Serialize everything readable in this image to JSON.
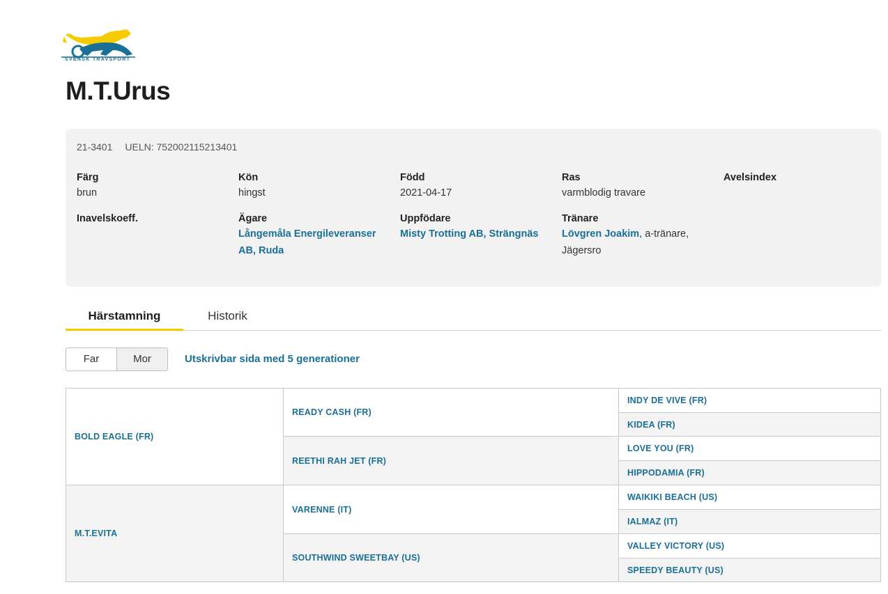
{
  "brand": {
    "logo_text": "SVENSK TRAVSPORT",
    "yellow": "#f4cc00",
    "blue": "#1a6f96"
  },
  "horse": {
    "name": "M.T.Urus",
    "reg_no": "21-3401",
    "ueln": "UELN: 752002115213401"
  },
  "info": {
    "farg": {
      "label": "Färg",
      "value": "brun"
    },
    "kon": {
      "label": "Kön",
      "value": "hingst"
    },
    "fodd": {
      "label": "Född",
      "value": "2021-04-17"
    },
    "ras": {
      "label": "Ras",
      "value": "varmblodig travare"
    },
    "avelsindex": {
      "label": "Avelsindex"
    },
    "inavel": {
      "label": "Inavelskoeff."
    },
    "agare": {
      "label": "Ägare",
      "line1": "Långemåla Energileveranser",
      "line2": "AB, Ruda"
    },
    "uppfodare": {
      "label": "Uppfödare",
      "value": "Misty Trotting AB, Strängnäs"
    },
    "tranare": {
      "label": "Tränare",
      "name": "Lövgren Joakim",
      "suffix": ", a-tränare,",
      "line2": "Jägersro"
    }
  },
  "tabs": {
    "pedigree": "Härstamning",
    "history": "Historik"
  },
  "toggle": {
    "father": "Far",
    "mother": "Mor"
  },
  "print_link": "Utskrivbar sida med 5 generationer",
  "pedigree": {
    "gen1": [
      "BOLD EAGLE (FR)",
      "M.T.EVITA"
    ],
    "gen2": [
      "READY CASH (FR)",
      "REETHI RAH JET (FR)",
      "VARENNE (IT)",
      "SOUTHWIND SWEETBAY (US)"
    ],
    "gen3": [
      "INDY DE VIVE (FR)",
      "KIDEA (FR)",
      "LOVE YOU (FR)",
      "HIPPODAMIA (FR)",
      "WAIKIKI BEACH (US)",
      "IALMAZ (IT)",
      "VALLEY VICTORY (US)",
      "SPEEDY BEAUTY (US)"
    ]
  }
}
